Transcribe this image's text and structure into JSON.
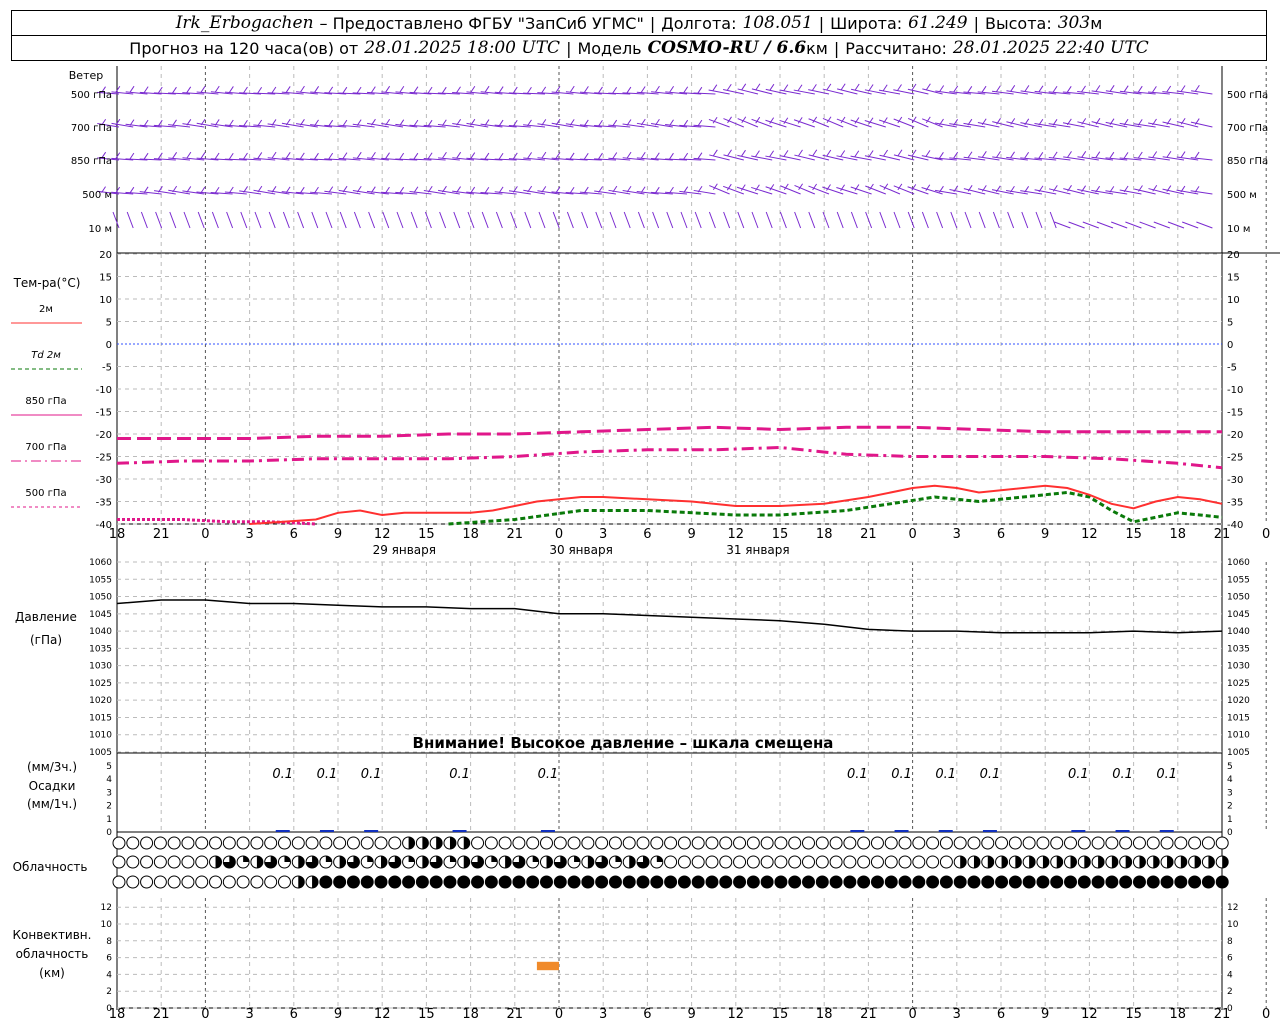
{
  "header": {
    "station": "Irk_Erbogachen",
    "provider": "– Предоставлено ФГБУ \"ЗапСиб УГМС\"",
    "lon_label": "Долгота:",
    "lon": "108.051",
    "lat_label": "Широта:",
    "lat": "61.249",
    "alt_label": "Высота:",
    "alt_value": "303",
    "alt_unit": "м",
    "forecast_label": "Прогноз на 120 часа(ов) от",
    "forecast_from": "28.01.2025 18:00 UTC",
    "model_label": "Модель",
    "model": "COSMO-RU / 6.6",
    "model_unit": "км",
    "calc_label": "Рассчитано:",
    "calc_time": "28.01.2025 22:40 UTC"
  },
  "labels": {
    "wind": "Ветер",
    "temp": "Тем-ра(°С)",
    "pressure1": "Давление",
    "pressure2": "(гПа)",
    "precip1": "(мм/3ч.)",
    "precip2": "Осадки",
    "precip3": "(мм/1ч.)",
    "cloud": "Облачность",
    "conv1": "Конвективн.",
    "conv2": "облачность",
    "conv3": "(км)",
    "warning": "Внимание! Высокое давление – шкала смещена",
    "wind_levels": [
      "500 гПа",
      "700 гПа",
      "850 гПа",
      "500 м",
      "10 м"
    ],
    "temp_legend": [
      {
        "text": "2м",
        "color": "#ff3030",
        "dash": ""
      },
      {
        "text": "Td 2м",
        "color": "#0a7a0a",
        "dash": "4,3"
      },
      {
        "text": "850 гПа",
        "color": "#e0178a",
        "dash": ""
      },
      {
        "text": "700 гПа",
        "color": "#e0178a",
        "dash": "10,4,2,4"
      },
      {
        "text": "500 гПа",
        "color": "#e0178a",
        "dash": "3,3"
      }
    ],
    "day_labels": [
      "29 января",
      "30 января",
      "31 января"
    ]
  },
  "chart_data": {
    "type": "meteogram",
    "time_ticks": [
      "18",
      "21",
      "0",
      "3",
      "6",
      "9",
      "12",
      "15",
      "18",
      "21",
      "0",
      "3",
      "6",
      "9",
      "12",
      "15",
      "18",
      "21",
      "0",
      "3",
      "6",
      "9",
      "12",
      "15",
      "18",
      "21",
      "0"
    ],
    "temperature": {
      "ylim": [
        -40,
        20
      ],
      "yticks": [
        "20",
        "15",
        "10",
        "5",
        "0",
        "-5",
        "-10",
        "-15",
        "-20",
        "-25",
        "-30",
        "-35",
        "-40"
      ],
      "t2m": [
        [
          6,
          -40
        ],
        [
          9,
          -39
        ],
        [
          10,
          -37.5
        ],
        [
          11,
          -37
        ],
        [
          12,
          -38
        ],
        [
          13,
          -37.5
        ],
        [
          16,
          -37.5
        ],
        [
          17,
          -37
        ],
        [
          18,
          -36
        ],
        [
          19,
          -35
        ],
        [
          21,
          -34
        ],
        [
          22,
          -34
        ],
        [
          24,
          -34.5
        ],
        [
          26,
          -35
        ],
        [
          27,
          -35.5
        ],
        [
          28,
          -36
        ],
        [
          30,
          -36
        ],
        [
          32,
          -35.5
        ],
        [
          34,
          -34
        ],
        [
          36,
          -32
        ],
        [
          37,
          -31.5
        ],
        [
          38,
          -32
        ],
        [
          39,
          -33
        ],
        [
          40,
          -32.5
        ],
        [
          42,
          -31.5
        ],
        [
          43,
          -32
        ],
        [
          44,
          -33.5
        ],
        [
          45,
          -35.5
        ],
        [
          46,
          -36.5
        ],
        [
          47,
          -35
        ],
        [
          48,
          -34
        ],
        [
          49,
          -34.5
        ],
        [
          50,
          -35.5
        ]
      ],
      "td2m": [
        [
          15,
          -40
        ],
        [
          18,
          -39
        ],
        [
          21,
          -37
        ],
        [
          24,
          -37
        ],
        [
          28,
          -38
        ],
        [
          30,
          -38
        ],
        [
          33,
          -37
        ],
        [
          35,
          -35.5
        ],
        [
          37,
          -34
        ],
        [
          39,
          -35
        ],
        [
          41,
          -34
        ],
        [
          43,
          -33
        ],
        [
          44,
          -34
        ],
        [
          45,
          -37
        ],
        [
          46,
          -39.5
        ],
        [
          47,
          -38.5
        ],
        [
          48,
          -37.5
        ],
        [
          49,
          -38
        ],
        [
          50,
          -38.5
        ]
      ],
      "t850": [
        [
          0,
          -21
        ],
        [
          3,
          -21
        ],
        [
          6,
          -21
        ],
        [
          9,
          -20.5
        ],
        [
          12,
          -20.5
        ],
        [
          15,
          -20
        ],
        [
          18,
          -20
        ],
        [
          21,
          -19.5
        ],
        [
          24,
          -19
        ],
        [
          27,
          -18.5
        ],
        [
          30,
          -19
        ],
        [
          33,
          -18.5
        ],
        [
          36,
          -18.5
        ],
        [
          39,
          -19
        ],
        [
          42,
          -19.5
        ],
        [
          45,
          -19.5
        ],
        [
          48,
          -19.5
        ],
        [
          50,
          -19.5
        ]
      ],
      "t700": [
        [
          0,
          -26.5
        ],
        [
          3,
          -26
        ],
        [
          6,
          -26
        ],
        [
          9,
          -25.5
        ],
        [
          12,
          -25.5
        ],
        [
          15,
          -25.5
        ],
        [
          18,
          -25
        ],
        [
          21,
          -24
        ],
        [
          24,
          -23.5
        ],
        [
          27,
          -23.5
        ],
        [
          30,
          -23
        ],
        [
          33,
          -24.5
        ],
        [
          36,
          -25
        ],
        [
          39,
          -25
        ],
        [
          42,
          -25
        ],
        [
          45,
          -25.5
        ],
        [
          48,
          -26.5
        ],
        [
          50,
          -27.5
        ]
      ],
      "t500": [
        [
          0,
          -39
        ],
        [
          3,
          -39
        ],
        [
          5,
          -39.5
        ],
        [
          7,
          -39.5
        ],
        [
          9,
          -40
        ]
      ]
    },
    "pressure": {
      "ylim": [
        1005,
        1060
      ],
      "yticks": [
        "1060",
        "1055",
        "1050",
        "1045",
        "1040",
        "1035",
        "1030",
        "1025",
        "1020",
        "1015",
        "1010",
        "1005"
      ],
      "values": [
        [
          0,
          1048
        ],
        [
          2,
          1049
        ],
        [
          4,
          1049
        ],
        [
          6,
          1048
        ],
        [
          8,
          1048
        ],
        [
          10,
          1047.5
        ],
        [
          12,
          1047
        ],
        [
          14,
          1047
        ],
        [
          16,
          1046.5
        ],
        [
          18,
          1046.5
        ],
        [
          20,
          1045
        ],
        [
          22,
          1045
        ],
        [
          24,
          1044.5
        ],
        [
          26,
          1044
        ],
        [
          28,
          1043.5
        ],
        [
          30,
          1043
        ],
        [
          32,
          1042
        ],
        [
          34,
          1040.5
        ],
        [
          36,
          1040
        ],
        [
          38,
          1040
        ],
        [
          40,
          1039.5
        ],
        [
          42,
          1039.5
        ],
        [
          44,
          1039.5
        ],
        [
          46,
          1040
        ],
        [
          48,
          1039.5
        ],
        [
          50,
          1040
        ]
      ]
    },
    "precip": {
      "yticks": [
        "5",
        "4",
        "3",
        "2",
        "1",
        "0"
      ],
      "labels": [
        {
          "t": 7.5,
          "text": "0.1"
        },
        {
          "t": 9.5,
          "text": "0.1"
        },
        {
          "t": 11.5,
          "text": "0.1"
        },
        {
          "t": 15.5,
          "text": "0.1"
        },
        {
          "t": 19.5,
          "text": "0.1"
        },
        {
          "t": 33.5,
          "text": "0.1"
        },
        {
          "t": 35.5,
          "text": "0.1"
        },
        {
          "t": 37.5,
          "text": "0.1"
        },
        {
          "t": 39.5,
          "text": "0.1"
        },
        {
          "t": 43.5,
          "text": "0.1"
        },
        {
          "t": 45.5,
          "text": "0.1"
        },
        {
          "t": 47.5,
          "text": "0.1"
        }
      ]
    },
    "convective": {
      "yticks": [
        "12",
        "10",
        "8",
        "6",
        "4",
        "2",
        "0"
      ],
      "segments": [
        {
          "t0": 19.0,
          "t1": 20.0,
          "base": 4.5,
          "top": 5.5,
          "color": "#f08a2a"
        }
      ]
    }
  }
}
